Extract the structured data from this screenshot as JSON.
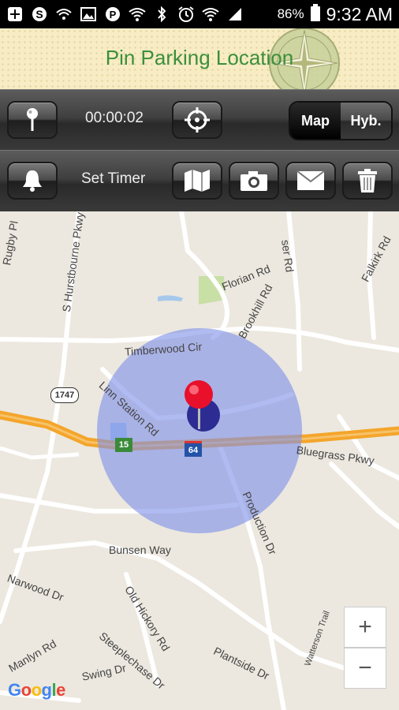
{
  "status_bar": {
    "icons": [
      "plus-box-icon",
      "skype-icon",
      "wifi-call-icon",
      "image-icon",
      "pinterest-icon",
      "wifi-icon",
      "bluetooth-icon",
      "alarm-icon",
      "wifi-signal-icon",
      "cell-signal-icon"
    ],
    "battery_pct": "86%",
    "time": "9:32 AM"
  },
  "header": {
    "title": "Pin Parking Location"
  },
  "toolbar1": {
    "timer": "00:00:02",
    "map_label": "Map",
    "hybrid_label": "Hyb.",
    "selected": "Map"
  },
  "toolbar2": {
    "set_timer_label": "Set Timer"
  },
  "map": {
    "labels": {
      "rugby": "Rugby Pl",
      "hurstbourne": "S Hurstbourne Pkwy",
      "florian": "Florian Rd",
      "brookhill": "Brookhill Rd",
      "ser": "ser Rd",
      "falkirk": "Falkirk Rd",
      "timberwood": "Timberwood Cir",
      "linn": "Linn Station Rd",
      "bluegrass": "Bluegrass Pkwy",
      "production": "Production Dr",
      "bunsen": "Bunsen Way",
      "narwood": "Narwood Dr",
      "oldhickory": "Old Hickory Rd",
      "steeplechase": "Steeplechase Dr",
      "swing": "Swing Dr",
      "plantside": "Plantside Dr",
      "watterson": "Watterson Trail",
      "manlyn": "Manlyn Rd"
    },
    "shields": {
      "route1747": "1747",
      "route15": "15",
      "i64": "64"
    },
    "zoom_in": "+",
    "zoom_out": "−",
    "attribution": "Google",
    "colors": {
      "accuracy_circle": "#7f92e8",
      "pin": "#e8102a",
      "highway": "#f4a52a"
    }
  }
}
